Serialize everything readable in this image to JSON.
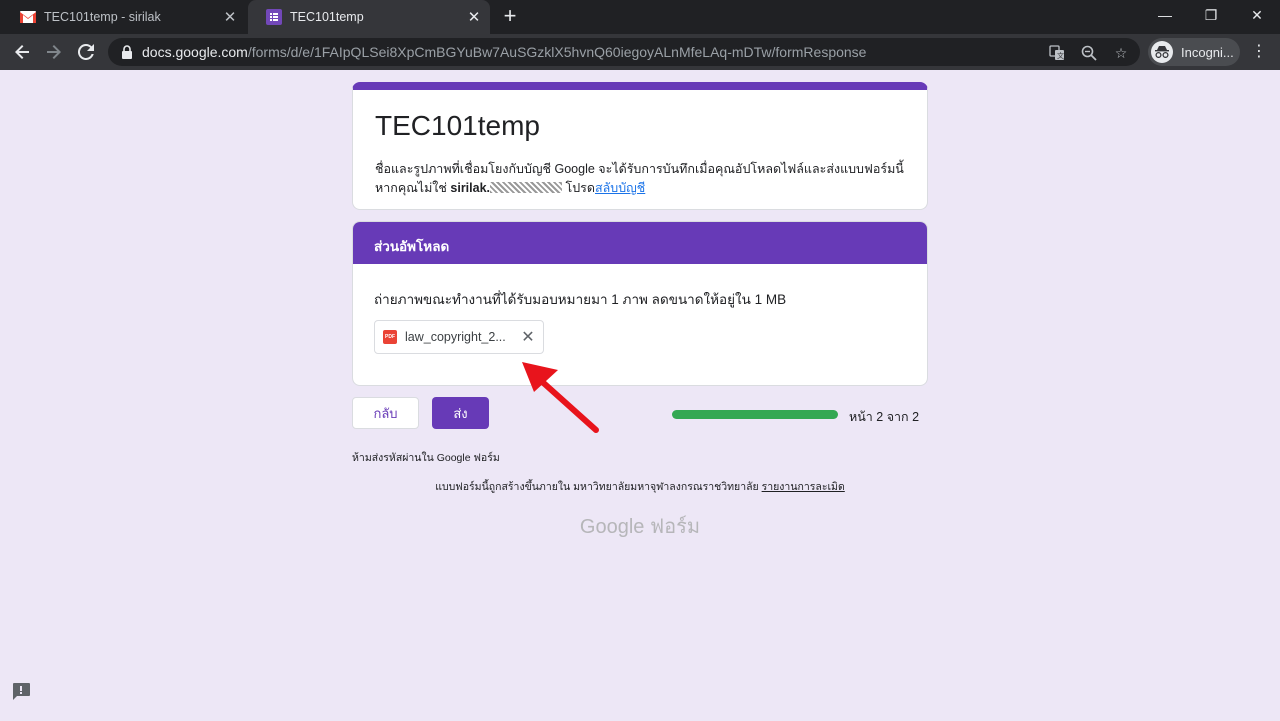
{
  "browser": {
    "tabs": [
      {
        "title": "TEC101temp - sirilak",
        "active": false,
        "icon": "gmail-icon"
      },
      {
        "title": "TEC101temp",
        "active": true,
        "icon": "google-forms-icon"
      }
    ],
    "url_host": "docs.google.com",
    "url_path": "/forms/d/e/1FAIpQLSei8XpCmBGYuBw7AuSGzklX5hvnQ60iegoyALnMfeLAq-mDTw/formResponse",
    "profile_label": "Incogni...",
    "colors": {
      "chrome_dark": "#202124",
      "chrome_toolbar": "#35363a"
    }
  },
  "form": {
    "title": "TEC101temp",
    "desc_line1": "ชื่อและรูปภาพที่เชื่อมโยงกับบัญชี Google จะได้รับการบันทึกเมื่อคุณอัปโหลดไฟล์และส่งแบบฟอร์มนี้",
    "desc_line2_prefix": "หากคุณไม่ใช่",
    "desc_user": "sirilak.",
    "desc_line2_mid": "โปรด",
    "switch_account_link": "สลับบัญชี",
    "section_title": "ส่วนอัพโหลด",
    "question": "ถ่ายภาพขณะทำงานที่ได้รับมอบหมายมา 1 ภาพ ลดขนาดให้อยู่ใน 1 MB",
    "file_icon_label": "PDF",
    "file_name": "law_copyright_2...",
    "back_label": "กลับ",
    "submit_label": "ส่ง",
    "progress_fraction": 1.0,
    "progress_text": "หน้า 2 จาก 2",
    "no_password_note": "ห้ามส่งรหัสผ่านใน Google ฟอร์ม",
    "footer_note": "แบบฟอร์มนี้ถูกสร้างขึ้นภายใน มหาวิทยาลัยมหาจุฬาลงกรณราชวิทยาลัย",
    "report_link": "รายงานการละเมิด",
    "logo_text": "Google ฟอร์ม",
    "colors": {
      "accent": "#673ab7",
      "background": "#ede7f6",
      "progress": "#34a853",
      "arrow": "#e8141c"
    }
  }
}
